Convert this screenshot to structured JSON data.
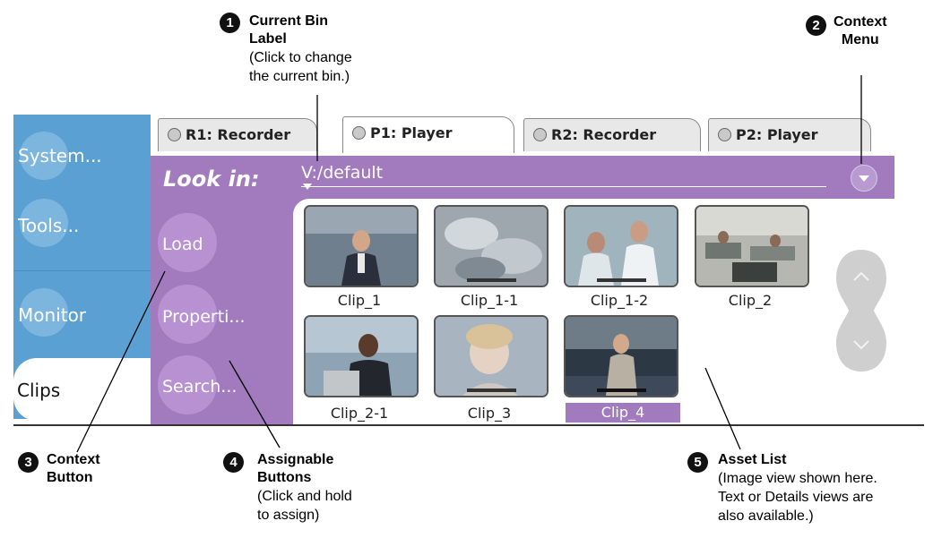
{
  "callouts": [
    {
      "num": "1",
      "title": "Current Bin Label",
      "title_lines": [
        "Current Bin",
        "Label"
      ],
      "desc_lines": [
        "(Click to change",
        "the current bin.)"
      ]
    },
    {
      "num": "2",
      "title_lines": [
        "Context",
        "Menu"
      ]
    },
    {
      "num": "3",
      "title_lines": [
        "Context",
        "Button"
      ]
    },
    {
      "num": "4",
      "title_lines": [
        "Assignable",
        "Buttons"
      ],
      "desc_lines": [
        "(Click and hold",
        "to assign)"
      ]
    },
    {
      "num": "5",
      "title_lines": [
        "Asset List"
      ],
      "desc_lines": [
        "(Image view shown here.",
        "Text or Details views are",
        "also available.)"
      ]
    }
  ],
  "sidebar": {
    "items": [
      {
        "label": "System..."
      },
      {
        "label": "Tools..."
      },
      {
        "label": "Monitor"
      },
      {
        "label": "Clips",
        "selected": true
      }
    ]
  },
  "tabs": [
    {
      "label": "R1: Recorder"
    },
    {
      "label": "P1: Player",
      "active": true
    },
    {
      "label": "R2: Recorder"
    },
    {
      "label": "P2: Player"
    }
  ],
  "bin": {
    "look_in_label": "Look in:",
    "path": "V:/default"
  },
  "assignable_buttons": [
    {
      "label": "Load"
    },
    {
      "label": "Properti..."
    },
    {
      "label": "Search..."
    }
  ],
  "clips": [
    {
      "name": "Clip_1"
    },
    {
      "name": "Clip_1-1"
    },
    {
      "name": "Clip_1-2"
    },
    {
      "name": "Clip_2"
    },
    {
      "name": "Clip_2-1"
    },
    {
      "name": "Clip_3"
    },
    {
      "name": "Clip_4",
      "selected": true
    }
  ],
  "colors": {
    "sidebar": "#5aa0d2",
    "panel": "#a27bbf",
    "selection": "#a27bbf"
  },
  "icons": {
    "context_menu": "chevron-down-icon",
    "scroll_up": "chevron-up-icon",
    "scroll_down": "chevron-down-icon",
    "tab_led": "status-led-icon"
  }
}
